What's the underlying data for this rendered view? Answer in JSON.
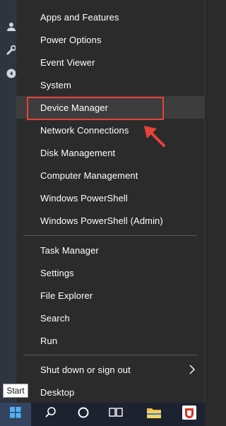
{
  "menu": {
    "items": [
      {
        "label": "Apps and Features"
      },
      {
        "label": "Power Options"
      },
      {
        "label": "Event Viewer"
      },
      {
        "label": "System"
      },
      {
        "label": "Device Manager"
      },
      {
        "label": "Network Connections"
      },
      {
        "label": "Disk Management"
      },
      {
        "label": "Computer Management"
      },
      {
        "label": "Windows PowerShell"
      },
      {
        "label": "Windows PowerShell (Admin)"
      },
      {
        "label": "Task Manager"
      },
      {
        "label": "Settings"
      },
      {
        "label": "File Explorer"
      },
      {
        "label": "Search"
      },
      {
        "label": "Run"
      },
      {
        "label": "Shut down or sign out"
      },
      {
        "label": "Desktop"
      }
    ]
  },
  "tooltip": {
    "label": "Start"
  },
  "taskbar": {
    "icons": [
      "windows-logo-icon",
      "search-icon",
      "cortana-circle-icon",
      "task-view-icon",
      "file-explorer-icon",
      "app-icon"
    ]
  },
  "colors": {
    "menu_bg": "#2b2b2b",
    "highlight": "#e8423a",
    "text": "#ffffff",
    "taskbar_bg": "#1c2230"
  }
}
